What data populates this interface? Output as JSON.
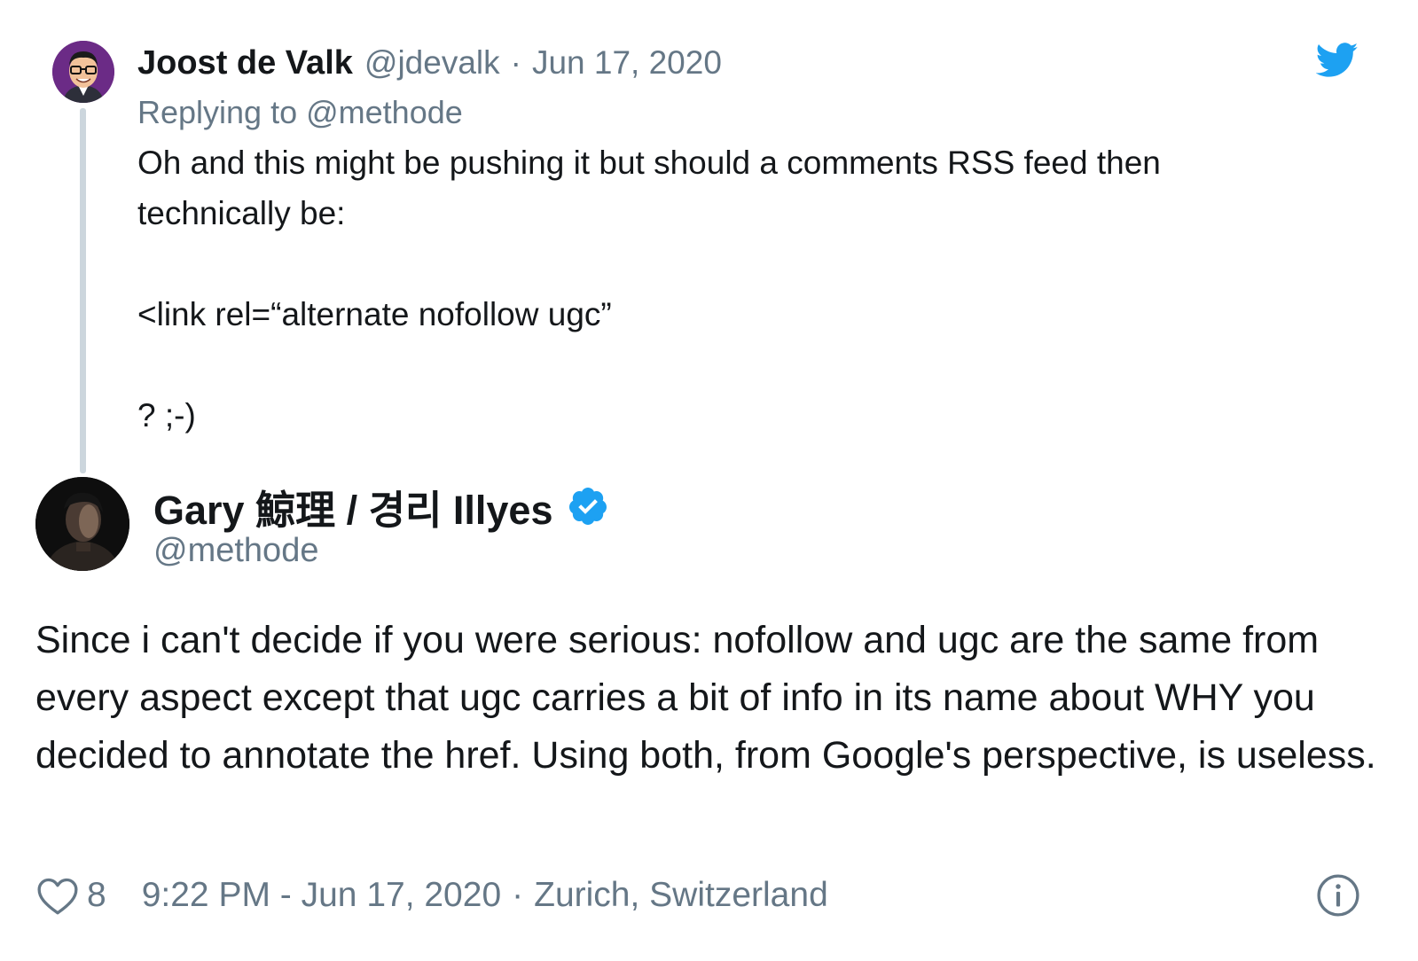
{
  "parent_tweet": {
    "author_name": "Joost de Valk",
    "handle": "@jdevalk",
    "separator": "·",
    "date": "Jun 17, 2020",
    "replying_to_prefix": "Replying to ",
    "replying_to_handle": "@methode",
    "text_lines": [
      "Oh and this might be pushing it but should a comments RSS feed then",
      "technically be:",
      "<link rel=“alternate nofollow ugc”",
      "? ;-)"
    ]
  },
  "main_tweet": {
    "author_name": "Gary 鯨理 / 경리 Illyes",
    "verified": true,
    "handle": "@methode",
    "text": "Since i can't decide if you were serious: nofollow and ugc are the same from every aspect except that ugc carries a bit of info in its name about WHY you decided to annotate the href. Using both, from Google's perspective, is useless."
  },
  "footer": {
    "like_count": "8",
    "timestamp": "9:22 PM - Jun 17, 2020",
    "separator": "·",
    "location": "Zurich, Switzerland"
  },
  "icons": {
    "brand_logo": "twitter-bird-icon",
    "verified": "verified-badge-icon",
    "like": "heart-icon",
    "info": "info-icon"
  },
  "colors": {
    "twitter_blue": "#1da1f2",
    "text_primary": "#14171a",
    "text_secondary": "#657786",
    "thread_line": "#ccd6dd"
  }
}
